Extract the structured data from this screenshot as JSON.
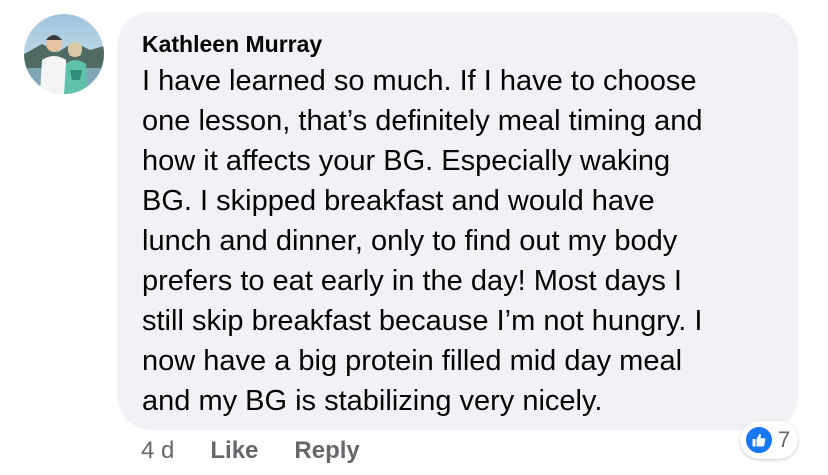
{
  "comment": {
    "author": "Kathleen Murray",
    "lines": [
      "I have learned so much. If I have to choose",
      "one lesson, that’s definitely meal timing and",
      "how it affects your BG. Especially waking",
      "BG. I skipped breakfast and would have",
      "lunch and dinner, only to find out my body",
      "prefers to eat early in the day! Most days I",
      "still skip breakfast because I’m not hungry. I",
      "now have a big protein filled mid day meal",
      "and my BG is stabilizing very nicely."
    ],
    "timestamp": "4 d",
    "like_label": "Like",
    "reply_label": "Reply",
    "reactions": {
      "icon": "thumbs-up-icon",
      "count": "7",
      "color": "#1877f2"
    }
  },
  "colors": {
    "bubble": "#f0f2f5",
    "text": "#050505",
    "secondary_text": "#65676b"
  }
}
